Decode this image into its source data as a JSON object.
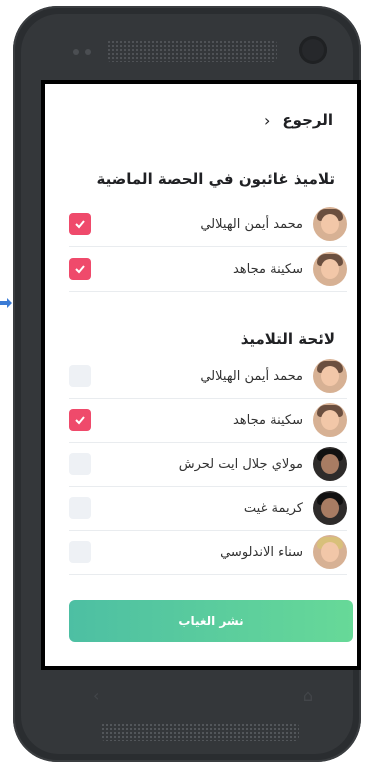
{
  "header": {
    "title": "الرجوع",
    "back_icon": "chevron-left-icon"
  },
  "absent_section": {
    "title": "تلاميذ غائبون في الحصة الماضية",
    "items": [
      {
        "name": "محمد أيمن الهيلالي",
        "checked": true,
        "avatar": "man-sunglasses-avatar"
      },
      {
        "name": "سكينة مجاهد",
        "checked": true,
        "avatar": "woman-avatar"
      }
    ]
  },
  "students_section": {
    "title": "لائحة التلاميذ",
    "items": [
      {
        "name": "محمد أيمن الهيلالي",
        "checked": false,
        "avatar": "man-sunglasses-avatar"
      },
      {
        "name": "سكينة مجاهد",
        "checked": true,
        "avatar": "woman-avatar"
      },
      {
        "name": "مولاي جلال ايت لحرش",
        "checked": false,
        "avatar": "man-dark-avatar"
      },
      {
        "name": "كريمة غيت",
        "checked": false,
        "avatar": "woman-dark-avatar"
      },
      {
        "name": "سناء الاندلوسي",
        "checked": false,
        "avatar": "woman-blond-avatar"
      }
    ]
  },
  "actions": {
    "publish_label": "نشر الغياب"
  },
  "colors": {
    "checked": "#ef4a6b",
    "button_start": "#4dbfa3",
    "button_end": "#67d998"
  },
  "device_nav": {
    "back": "‹",
    "home": "⌂"
  }
}
